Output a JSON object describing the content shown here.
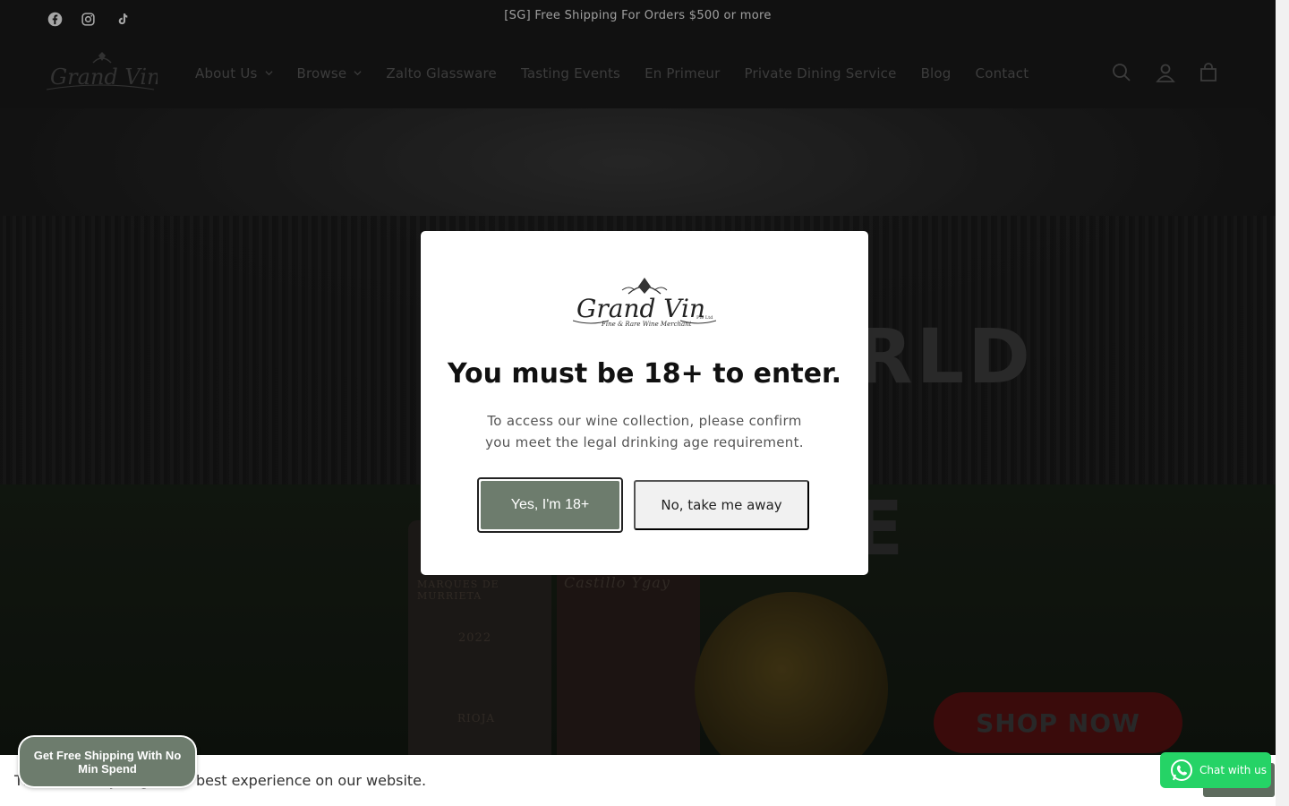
{
  "announcement": {
    "text": "[SG] Free Shipping For Orders $500 or more",
    "social": [
      "facebook-icon",
      "instagram-icon",
      "tiktok-icon"
    ]
  },
  "header": {
    "nav": [
      {
        "label": "About Us",
        "has_dropdown": true
      },
      {
        "label": "Browse",
        "has_dropdown": true
      },
      {
        "label": "Zalto Glassware",
        "has_dropdown": false
      },
      {
        "label": "Tasting Events",
        "has_dropdown": false
      },
      {
        "label": "En Primeur",
        "has_dropdown": false
      },
      {
        "label": "Private Dining Service",
        "has_dropdown": false
      },
      {
        "label": "Blog",
        "has_dropdown": false
      },
      {
        "label": "Contact",
        "has_dropdown": false
      }
    ],
    "icons": [
      "search-icon",
      "account-icon",
      "cart-icon"
    ]
  },
  "hero": {
    "headline_fragment": "RLD",
    "headline_fragment_2": "E",
    "bottle_label_1": "MARQUES DE MURRIETA",
    "bottle_year_1": "2022",
    "bottle_region_1": "RIOJA",
    "bottle_label_2": "Castillo Ygay",
    "cta": "SHOP NOW"
  },
  "age_gate": {
    "brand": "Grand Vin",
    "brand_suffix": "Pte Ltd",
    "tagline": "Fine & Rare Wine Merchant",
    "title": "You must be 18+ to enter.",
    "text": "To access our wine collection, please confirm you meet the legal drinking age requirement.",
    "confirm_label": "Yes, I'm 18+",
    "decline_label": "No, take me away"
  },
  "cookie": {
    "text": "Th                          to ensure you get the best experience on our website."
  },
  "free_shipping_pill": "Get Free Shipping With No Min Spend",
  "chat": {
    "label": "Chat with us"
  },
  "colors": {
    "header_bg": "#1b1b1b",
    "accent_green": "#6d7c6d",
    "whatsapp": "#25d366",
    "modal_bg": "#ffffff"
  }
}
